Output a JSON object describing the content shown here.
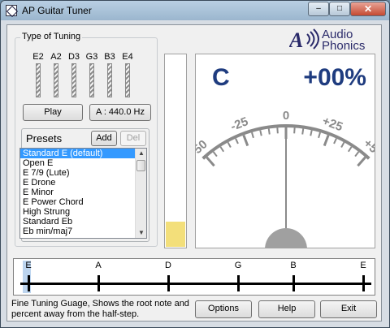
{
  "window": {
    "title": "AP Guitar Tuner",
    "minimize_glyph": "–",
    "maximize_glyph": "□",
    "close_glyph": "✕"
  },
  "tuning": {
    "group_title": "Type of Tuning",
    "strings": [
      "E2",
      "A2",
      "D3",
      "G3",
      "B3",
      "E4"
    ],
    "play_button": "Play",
    "frequency_button": "A : 440.0 Hz"
  },
  "presets": {
    "group_title": "Presets",
    "add_button": "Add",
    "del_button": "Del",
    "selected_index": 0,
    "items": [
      "Standard E (default)",
      "Open E",
      "E 7/9 (Lute)",
      "E Drone",
      "E Minor",
      "E Power Chord",
      "High Strung",
      "Standard Eb",
      "Eb min/maj7"
    ]
  },
  "logo": {
    "line1": "Audio",
    "line2": "Phonics",
    "mark_text": "A"
  },
  "level_meter": {
    "level_fraction": 0.13,
    "fill_color": "#f3df7a"
  },
  "tuner": {
    "note": "C",
    "cents_display": "+00%",
    "dial_labels": [
      "-50",
      "-25",
      "0",
      "+25",
      "+50"
    ],
    "needle_cents": 0,
    "text_color": "#1f3c7f"
  },
  "fine_gauge": {
    "labels": [
      "E",
      "A",
      "D",
      "G",
      "B",
      "E"
    ],
    "highlight_index": 0
  },
  "status": {
    "text": "Fine Tuning Guage, Shows the root note and percent away from the half-step."
  },
  "buttons": {
    "options": "Options",
    "help": "Help",
    "exit": "Exit"
  }
}
